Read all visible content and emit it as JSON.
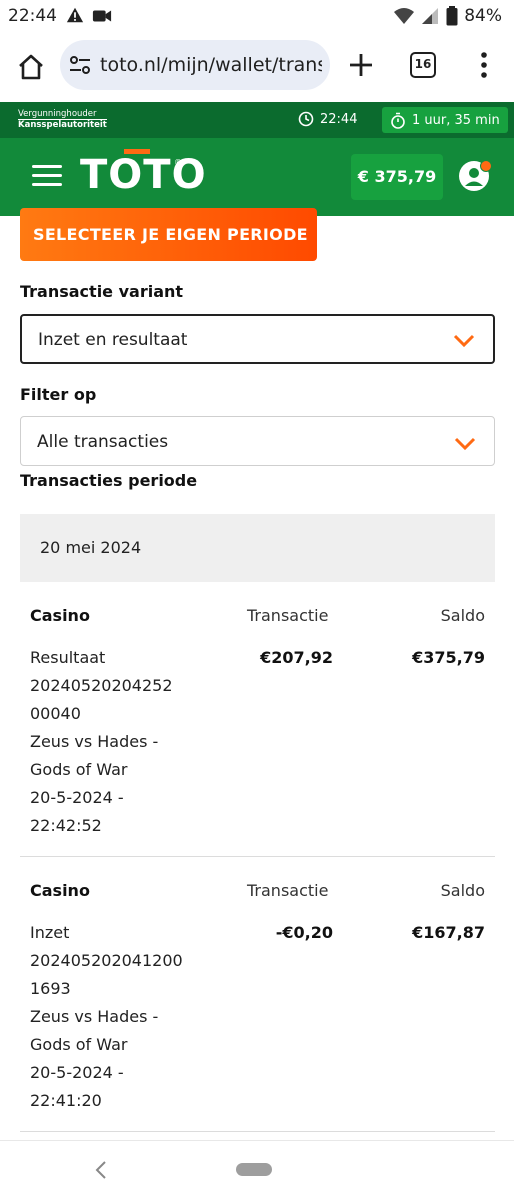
{
  "status_bar": {
    "time": "22:44",
    "battery": "84%",
    "icons": [
      "warning-icon",
      "video-record-icon",
      "wifi-icon",
      "signal-icon",
      "battery-icon"
    ]
  },
  "browser": {
    "url": "toto.nl/mijn/wallet/transa",
    "tab_count": "16"
  },
  "info_strip": {
    "license_line1": "Vergunninghouder",
    "license_line2": "Kansspelautoriteit",
    "clock_time": "22:44",
    "session_time": "1 uur, 35 min"
  },
  "header": {
    "logo_text": "TOTO",
    "logo_reg": "®",
    "balance": "€ 375,79"
  },
  "period_button_label": "SELECTEER JE EIGEN PERIODE",
  "variant": {
    "label": "Transactie variant",
    "value": "Inzet en resultaat"
  },
  "filter": {
    "label": "Filter op",
    "value": "Alle transacties"
  },
  "period_label": "Transacties periode",
  "date_group": "20 mei 2024",
  "columns": {
    "transaction": "Transactie",
    "balance": "Saldo"
  },
  "transactions": [
    {
      "category": "Casino",
      "type": "Resultaat",
      "id_part1": "20240520204252",
      "id_part2": "00040",
      "game_line1": "Zeus vs Hades -",
      "game_line2": "Gods of War",
      "date_line1": "20-5-2024 -",
      "date_line2": "22:42:52",
      "amount": "€207,92",
      "balance": "€375,79"
    },
    {
      "category": "Casino",
      "type": "Inzet",
      "id_part1": "202405202041200",
      "id_part2": "1693",
      "game_line1": "Zeus vs Hades -",
      "game_line2": "Gods of War",
      "date_line1": "20-5-2024 -",
      "date_line2": "22:41:20",
      "amount": "-€0,20",
      "balance": "€167,87"
    }
  ],
  "colors": {
    "dark_green": "#0b6b2e",
    "green": "#128a3a",
    "light_green": "#17a13f",
    "orange": "#ff6a13"
  }
}
